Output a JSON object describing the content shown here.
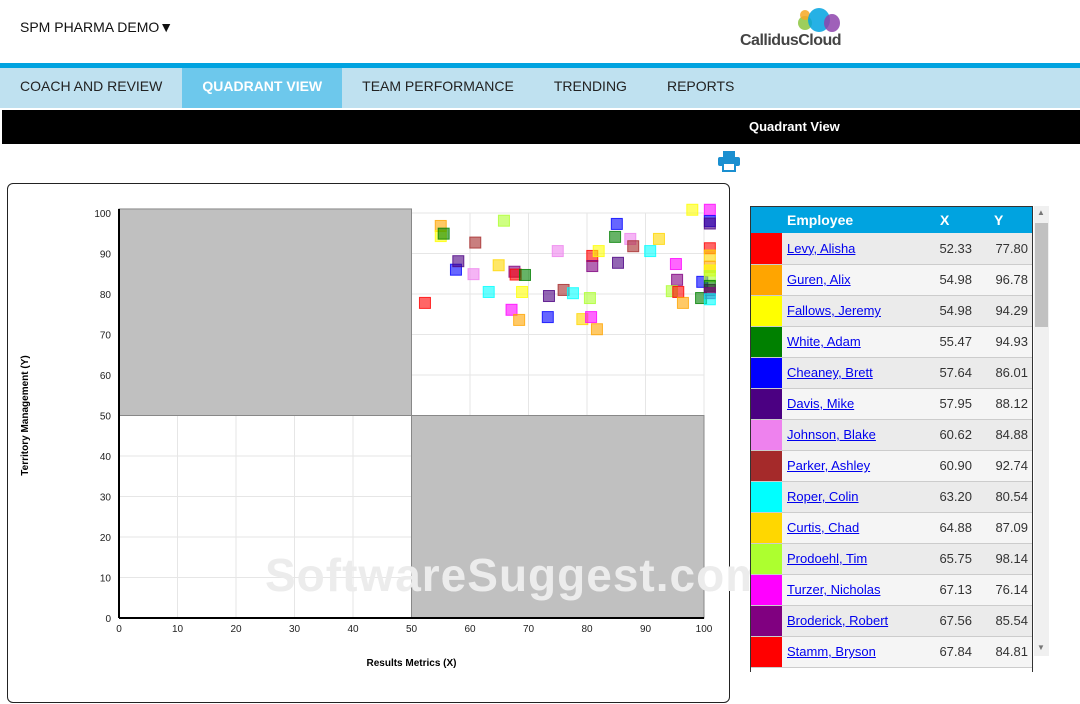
{
  "header": {
    "org_selector": "SPM PHARMA DEMO▼",
    "logo_text": "CallidusCloud"
  },
  "nav": {
    "tabs": [
      {
        "label": "COACH AND REVIEW",
        "active": false
      },
      {
        "label": "QUADRANT VIEW",
        "active": true
      },
      {
        "label": "TEAM PERFORMANCE",
        "active": false
      },
      {
        "label": "TRENDING",
        "active": false
      },
      {
        "label": "REPORTS",
        "active": false
      }
    ]
  },
  "page": {
    "title": "Quadrant View",
    "print_icon": "printer-icon",
    "watermark": "SoftwareSuggest.com"
  },
  "table": {
    "headers": {
      "employee": "Employee",
      "x": "X",
      "y": "Y"
    },
    "rows": [
      {
        "color": "#ff0000",
        "name": "Levy, Alisha",
        "x": "52.33",
        "y": "77.80"
      },
      {
        "color": "#ffa500",
        "name": "Guren, Alix",
        "x": "54.98",
        "y": "96.78"
      },
      {
        "color": "#ffff00",
        "name": "Fallows, Jeremy",
        "x": "54.98",
        "y": "94.29"
      },
      {
        "color": "#008000",
        "name": "White, Adam",
        "x": "55.47",
        "y": "94.93"
      },
      {
        "color": "#0000ff",
        "name": "Cheaney, Brett",
        "x": "57.64",
        "y": "86.01"
      },
      {
        "color": "#4b0082",
        "name": "Davis, Mike",
        "x": "57.95",
        "y": "88.12"
      },
      {
        "color": "#ee82ee",
        "name": "Johnson, Blake",
        "x": "60.62",
        "y": "84.88"
      },
      {
        "color": "#a52a2a",
        "name": "Parker, Ashley",
        "x": "60.90",
        "y": "92.74"
      },
      {
        "color": "#00ffff",
        "name": "Roper, Colin",
        "x": "63.20",
        "y": "80.54"
      },
      {
        "color": "#ffd700",
        "name": "Curtis, Chad",
        "x": "64.88",
        "y": "87.09"
      },
      {
        "color": "#adff2f",
        "name": "Prodoehl, Tim",
        "x": "65.75",
        "y": "98.14"
      },
      {
        "color": "#ff00ff",
        "name": "Turzer, Nicholas",
        "x": "67.13",
        "y": "76.14"
      },
      {
        "color": "#800080",
        "name": "Broderick, Robert",
        "x": "67.56",
        "y": "85.54"
      },
      {
        "color": "#ff0000",
        "name": "Stamm, Bryson",
        "x": "67.84",
        "y": "84.81"
      }
    ]
  },
  "chart_data": {
    "type": "scatter",
    "xlabel": "Results Metrics (X)",
    "ylabel": "Territory Management (Y)",
    "xlim": [
      0,
      100
    ],
    "ylim": [
      0,
      100
    ],
    "quadrant_split": [
      50,
      50
    ],
    "grid": true,
    "xticks": [
      "0",
      "10",
      "20",
      "30",
      "40",
      "50",
      "60",
      "70",
      "80",
      "90",
      "100"
    ],
    "yticks": [
      "0",
      "10",
      "20",
      "30",
      "40",
      "50",
      "60",
      "70",
      "80",
      "90",
      "100"
    ],
    "points": [
      [
        52.3,
        77.8,
        "#ff0000"
      ],
      [
        55,
        96.8,
        "#ffa500"
      ],
      [
        55,
        94.3,
        "#ffff00"
      ],
      [
        55.5,
        94.9,
        "#008000"
      ],
      [
        57.6,
        86,
        "#0000ff"
      ],
      [
        58,
        88.1,
        "#4b0082"
      ],
      [
        60.6,
        84.9,
        "#ee82ee"
      ],
      [
        60.9,
        92.7,
        "#a52a2a"
      ],
      [
        63.2,
        80.5,
        "#00ffff"
      ],
      [
        64.9,
        87.1,
        "#ffd700"
      ],
      [
        65.8,
        98.1,
        "#adff2f"
      ],
      [
        67.1,
        76.1,
        "#ff00ff"
      ],
      [
        67.6,
        85.5,
        "#800080"
      ],
      [
        67.8,
        84.8,
        "#ff0000"
      ],
      [
        69.4,
        84.7,
        "#008000"
      ],
      [
        68.9,
        80.5,
        "#ffff00"
      ],
      [
        68.4,
        73.6,
        "#ffa500"
      ],
      [
        73.5,
        79.5,
        "#4b0082"
      ],
      [
        76,
        81,
        "#a52a2a"
      ],
      [
        77.6,
        80.2,
        "#00ffff"
      ],
      [
        73.3,
        74.3,
        "#0000ff"
      ],
      [
        75,
        90.6,
        "#ee82ee"
      ],
      [
        80.5,
        79,
        "#adff2f"
      ],
      [
        79.2,
        73.8,
        "#ffd700"
      ],
      [
        80.7,
        74.3,
        "#ff00ff"
      ],
      [
        81.7,
        71.3,
        "#ffa500"
      ],
      [
        80.9,
        89.4,
        "#ff0000"
      ],
      [
        80.9,
        86.9,
        "#800080"
      ],
      [
        82,
        90.6,
        "#ffff00"
      ],
      [
        85.1,
        97.3,
        "#0000ff"
      ],
      [
        84.8,
        94.1,
        "#008000"
      ],
      [
        87.4,
        93.6,
        "#ee82ee"
      ],
      [
        87.9,
        91.8,
        "#a52a2a"
      ],
      [
        85.3,
        87.7,
        "#4b0082"
      ],
      [
        90.8,
        90.6,
        "#00ffff"
      ],
      [
        92.3,
        93.6,
        "#ffd700"
      ],
      [
        98,
        100.8,
        "#ffff00"
      ],
      [
        95.2,
        87.4,
        "#ff00ff"
      ],
      [
        95.4,
        83.5,
        "#800080"
      ],
      [
        94.5,
        80.7,
        "#adff2f"
      ],
      [
        95.6,
        80.5,
        "#ff0000"
      ],
      [
        96.4,
        77.8,
        "#ffa500"
      ],
      [
        99.7,
        83,
        "#0000ff"
      ],
      [
        99.5,
        79,
        "#008000"
      ],
      [
        101,
        100.8,
        "#ff00ff"
      ],
      [
        101,
        98,
        "#0000ff"
      ],
      [
        101,
        97.4,
        "#4b0082"
      ],
      [
        101,
        91.3,
        "#ff0000"
      ],
      [
        101,
        89.5,
        "#ffd700"
      ],
      [
        101,
        86.7,
        "#ffa500"
      ],
      [
        101,
        85.8,
        "#ffff00"
      ],
      [
        101,
        84.4,
        "#adff2f"
      ],
      [
        101,
        82,
        "#008000"
      ],
      [
        101,
        81,
        "#333333"
      ],
      [
        101,
        80.2,
        "#800080"
      ],
      [
        101,
        78.7,
        "#00ffff"
      ]
    ]
  }
}
